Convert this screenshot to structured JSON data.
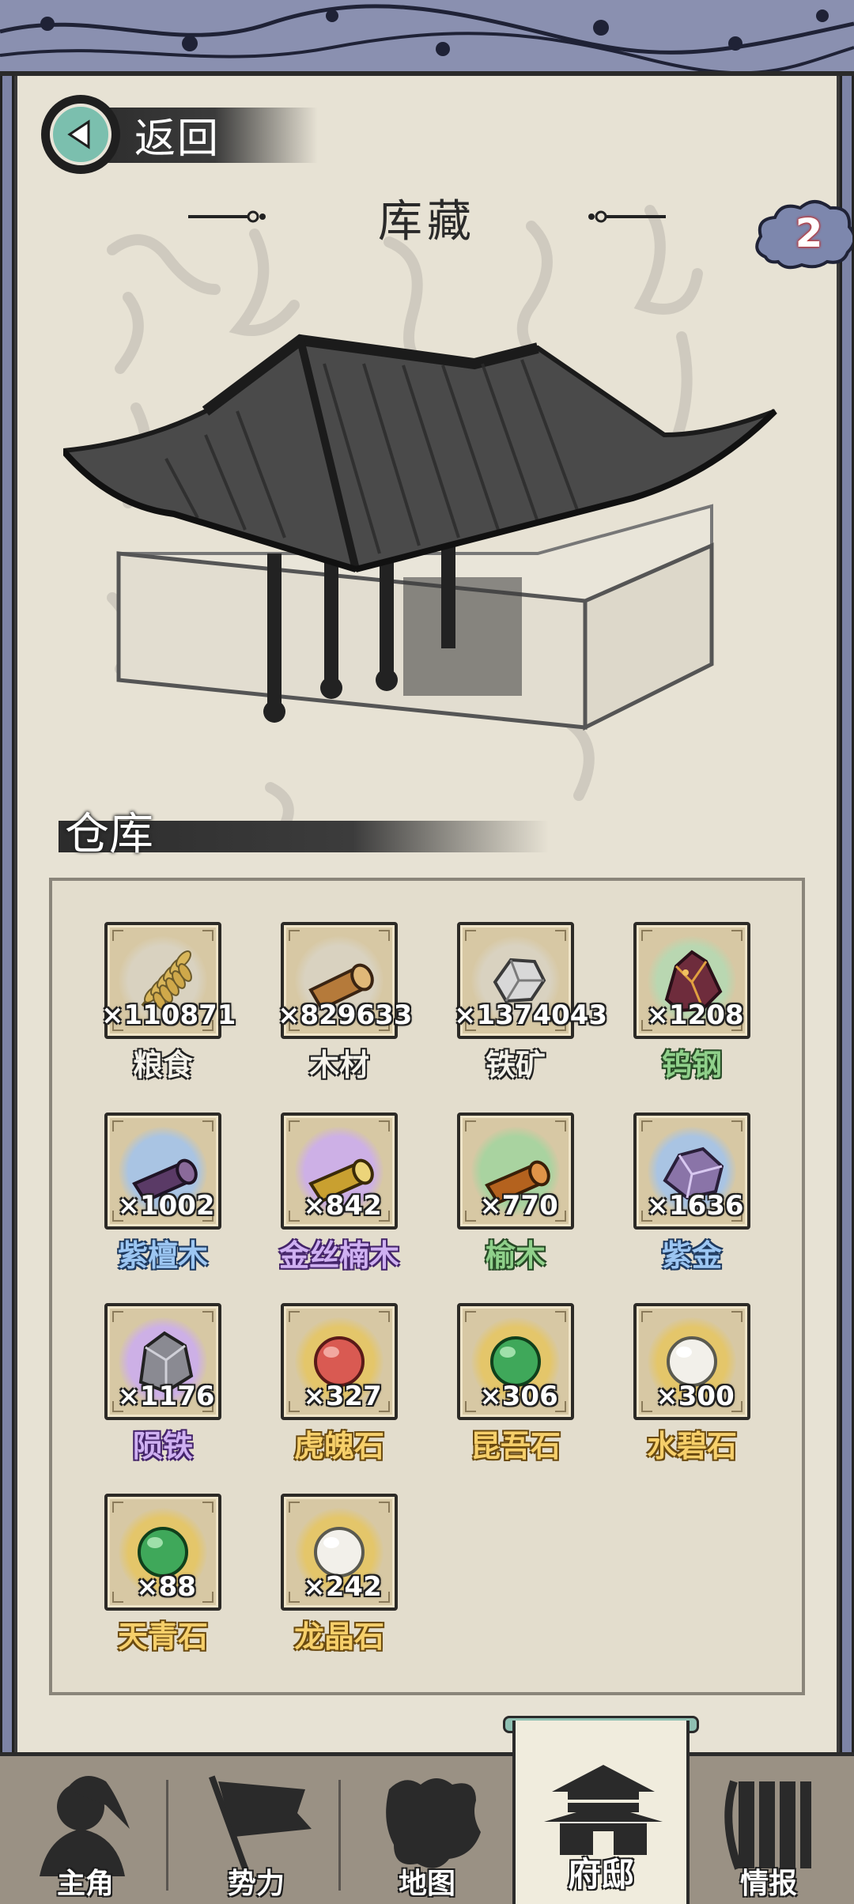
{
  "header": {
    "back_label": "返回",
    "title": "库藏",
    "badge_count": "2"
  },
  "warehouse": {
    "section_title": "仓库",
    "items": [
      {
        "name": "粮食",
        "count": "×110871",
        "quality": "white",
        "icon": "grain-icon",
        "glow": "#d9d2c0"
      },
      {
        "name": "木材",
        "count": "×829633",
        "quality": "white",
        "icon": "log-icon",
        "glow": "#d9d2c0"
      },
      {
        "name": "铁矿",
        "count": "×1374043",
        "quality": "white",
        "icon": "iron-ore-icon",
        "glow": "#d9d2c0"
      },
      {
        "name": "钨钢",
        "count": "×1208",
        "quality": "green",
        "icon": "tungsten-crystal-icon",
        "glow": "#b9d7b1"
      },
      {
        "name": "紫檀木",
        "count": "×1002",
        "quality": "blue",
        "icon": "dark-log-icon",
        "glow": "#a9c4e3"
      },
      {
        "name": "金丝楠木",
        "count": "×842",
        "quality": "purple",
        "icon": "golden-log-icon",
        "glow": "#cdb0e6"
      },
      {
        "name": "榆木",
        "count": "×770",
        "quality": "green",
        "icon": "elm-log-icon",
        "glow": "#a9d3a0"
      },
      {
        "name": "紫金",
        "count": "×1636",
        "quality": "blue",
        "icon": "purple-ore-icon",
        "glow": "#a9c4e3"
      },
      {
        "name": "陨铁",
        "count": "×1176",
        "quality": "purple",
        "icon": "meteor-iron-icon",
        "glow": "#cdb0e6"
      },
      {
        "name": "虎魄石",
        "count": "×327",
        "quality": "gold",
        "icon": "red-orb-icon",
        "glow": "#e4c66a"
      },
      {
        "name": "昆吾石",
        "count": "×306",
        "quality": "gold",
        "icon": "green-orb-icon",
        "glow": "#e4c66a"
      },
      {
        "name": "水碧石",
        "count": "×300",
        "quality": "gold",
        "icon": "white-orb-icon",
        "glow": "#e4c66a"
      },
      {
        "name": "天青石",
        "count": "×88",
        "quality": "gold",
        "icon": "green-orb-icon",
        "glow": "#e4c66a"
      },
      {
        "name": "龙晶石",
        "count": "×242",
        "quality": "gold",
        "icon": "white-orb-icon",
        "glow": "#e4c66a"
      }
    ]
  },
  "nav": {
    "items": [
      {
        "label": "主角",
        "icon": "hero-icon"
      },
      {
        "label": "势力",
        "icon": "flag-icon"
      },
      {
        "label": "地图",
        "icon": "map-icon"
      },
      {
        "label": "府邸",
        "icon": "mansion-icon",
        "active": true
      },
      {
        "label": "情报",
        "icon": "scroll-icon"
      }
    ]
  },
  "colors": {
    "paper": "#e7e2d4",
    "frame": "#8a90b0",
    "back_button": "#7bbfae",
    "nav_bg": "#9a9184"
  }
}
